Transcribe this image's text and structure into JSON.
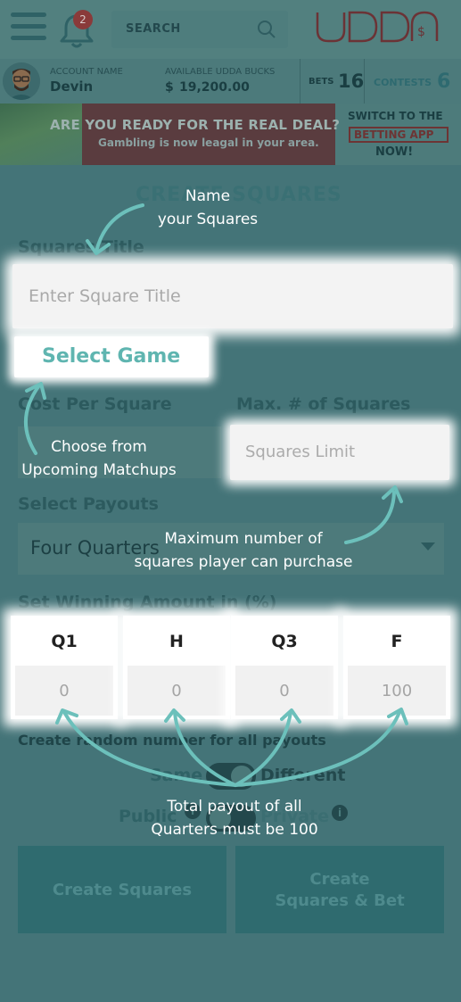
{
  "header": {
    "notification_count": "2",
    "search_label": "SEARCH",
    "logo_text": "UDDA",
    "logo_currency": "$"
  },
  "account": {
    "name_label": "ACCOUNT NAME",
    "name": "Devin",
    "bucks_label": "AVAILABLE UDDA BUCKS",
    "bucks_symbol": "$",
    "bucks_value": "19,200.00",
    "bets_label": "BETS",
    "bets_count": "16",
    "contests_label": "CONTESTS",
    "contests_count": "6"
  },
  "banner": {
    "headline": "ARE YOU READY FOR THE REAL DEAL?",
    "subline": "Gambling is now leagal in your area.",
    "switch_line1": "SWITCH TO THE",
    "switch_line2": "BETTING APP",
    "switch_line3": "NOW!"
  },
  "form": {
    "page_title": "CREATE SQUARES",
    "title_label": "Squares Title",
    "title_placeholder": "Enter Square Title",
    "select_game": "Select Game",
    "cost_label": "Cost Per Square",
    "max_label": "Max. # of Squares",
    "limit_placeholder": "Squares Limit",
    "payouts_label": "Select Payouts",
    "payouts_value": "Four Quarters",
    "winning_label": "Set Winning Amount in (%)",
    "quarters": [
      {
        "label": "Q1",
        "value": "0"
      },
      {
        "label": "H",
        "value": "0"
      },
      {
        "label": "Q3",
        "value": "0"
      },
      {
        "label": "F",
        "value": "100"
      }
    ],
    "random_label": "Create random number for all payouts",
    "same_label": "Same",
    "different_label": "Different",
    "public_label": "Public",
    "private_label": "Private",
    "info_symbol": "i",
    "create_button": "Create Squares",
    "create_bet_line1": "Create",
    "create_bet_line2": "Squares & Bet"
  },
  "annotations": {
    "name_line1": "Name",
    "name_line2": "your Squares",
    "choose_line1": "Choose from",
    "choose_line2": "Upcoming Matchups",
    "max_line1": "Maximum number of",
    "max_line2": "squares player can purchase",
    "total_line1": "Total payout of all",
    "total_line2": "Quarters must be 100"
  },
  "colors": {
    "accent": "#5fb5b0",
    "dim_overlay": "#447478",
    "annotation_arrow": "#6cc0bb"
  }
}
